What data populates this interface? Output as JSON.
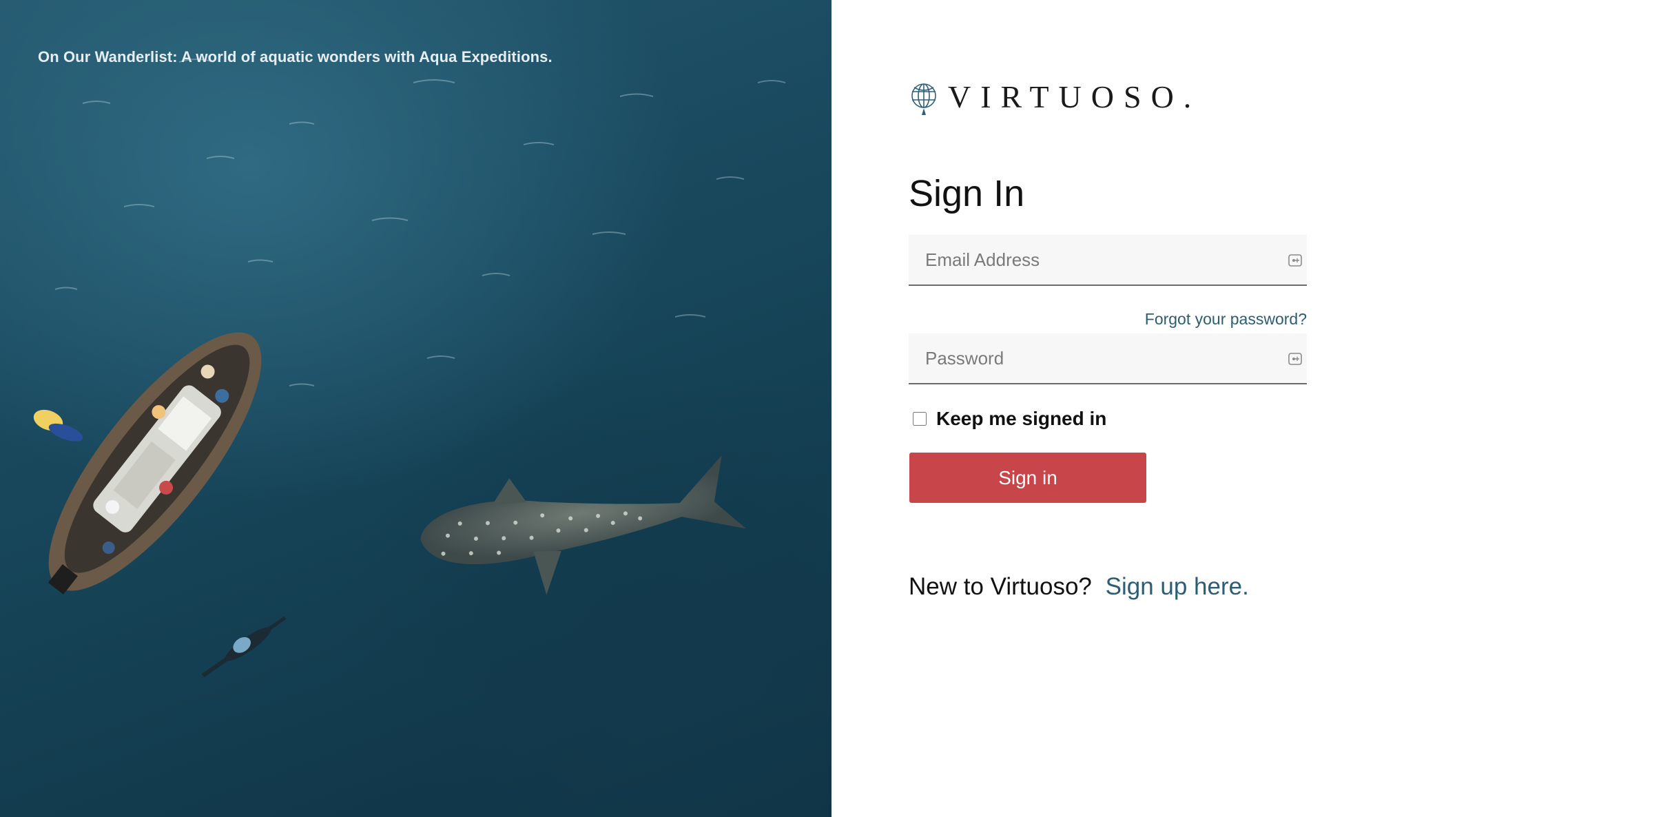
{
  "hero": {
    "caption": "On Our Wanderlist: A world of aquatic wonders with Aqua Expeditions."
  },
  "brand": {
    "logo_text": "VIRTUOSO.",
    "logo_icon": "globe-icon"
  },
  "signin": {
    "title": "Sign In",
    "email_placeholder": "Email Address",
    "email_value": "",
    "password_placeholder": "Password",
    "password_value": "",
    "forgot_password_label": "Forgot your password?",
    "keep_signed_in_label": "Keep me signed in",
    "keep_signed_in_checked": false,
    "submit_label": "Sign in",
    "new_user_text": "New to Virtuoso?",
    "signup_link_label": "Sign up here."
  },
  "colors": {
    "accent_button": "#c8454a",
    "link": "#2b5d75",
    "field_background": "#f7f7f7"
  }
}
